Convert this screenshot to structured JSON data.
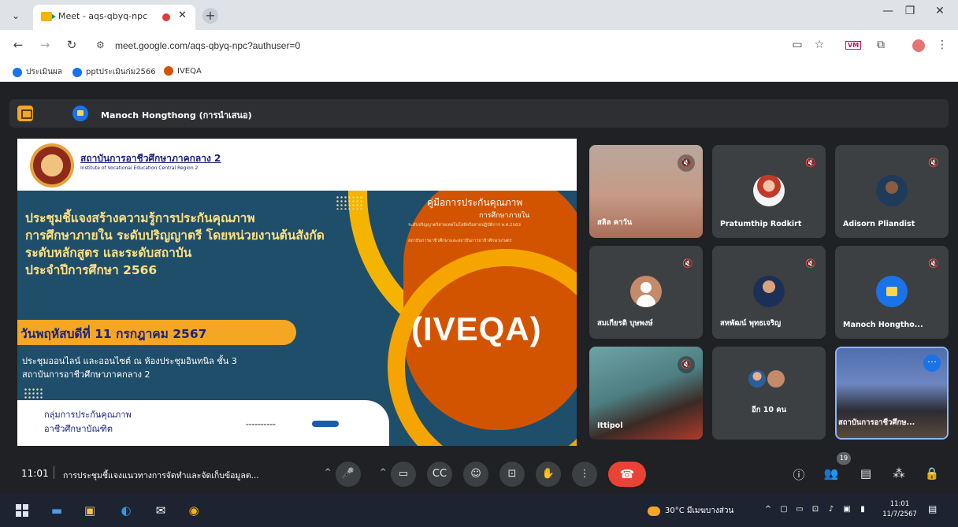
{
  "browser": {
    "tab_title": "Meet - aqs-qbyq-npc",
    "url": "meet.google.com/aqs-qbyq-npc?authuser=0",
    "bookmarks": [
      "ประเมินผล",
      "pptประเมินก่ม2566",
      "IVEQA"
    ],
    "extension_label": "VM"
  },
  "meet": {
    "presenter_name": "Manoch Hongthong (การนำเสนอ)",
    "time": "11:01",
    "meeting_title": "การประชุมชี้แจงแนวทางการจัดทำและจัดเก็บข้อมูลต...",
    "participant_count": "19"
  },
  "slide": {
    "org_th": "สถาบันการอาชีวศึกษาภาคกลาง 2",
    "org_en": "Institute of Vocational Education Central Region 2",
    "title_lines": [
      "ประชุมชี้แจงสร้างความรู้การประกันคุณภาพ",
      "การศึกษาภายใน ระดับปริญญาตรี โดยหน่วยงานต้นสังกัด",
      "ระดับหลักสูตร และระดับสถาบัน",
      "ประจำปีการศึกษา 2566"
    ],
    "date": "วันพฤหัสบดีที่ 11 กรกฎาคม 2567",
    "venue_lines": [
      "ประชุมออนไลน์ และออนไซต์ ณ ห้องประชุมอินทนิล ชั้น 3",
      "สถาบันการอาชีวศึกษาภาคกลาง 2"
    ],
    "manual_title": "คู่มือการประกันคุณภาพ",
    "manual_sub": "การศึกษาภายใน",
    "manual_s1": "ระดับปริญญาตรีสายเทคโนโลยีหรือสายปฏิบัติการ พ.ศ.2563",
    "manual_s2": "สถาบันการอาชีวศึกษาและสถาบันการอาชีวศึกษาเกษตร",
    "iveqa": "(IVEQA)",
    "group_lines": [
      "กลุ่มการประกันคุณภาพ",
      "อาชีวศึกษาบัณฑิต"
    ]
  },
  "participants": [
    {
      "name": "สลิล คาวัน",
      "muted": true
    },
    {
      "name": "Pratumthip Rodkirt",
      "muted": true
    },
    {
      "name": "Adisorn Pliandist",
      "muted": true
    },
    {
      "name": "สมเกียรติ บุษพงษ์",
      "muted": true
    },
    {
      "name": "สหพัฒน์ พุทธเจริญ",
      "muted": true
    },
    {
      "name": "Manoch Hongtho...",
      "muted": true
    },
    {
      "name": "Ittipol",
      "muted": true
    },
    {
      "name": "อีก 10 คน",
      "muted": false
    },
    {
      "name": "สถาบันการอาชีวศึกษ...",
      "muted": false
    }
  ],
  "taskbar": {
    "weather": "30°C มีเมฆบางส่วน",
    "time": "11:01",
    "date": "11/7/2567"
  },
  "colors": {
    "meet_bg": "#202124",
    "hangup": "#ea4335",
    "slide_navy": "#1f4e6b",
    "slide_orange": "#f5a623",
    "accent_blue": "#1a73e8"
  }
}
